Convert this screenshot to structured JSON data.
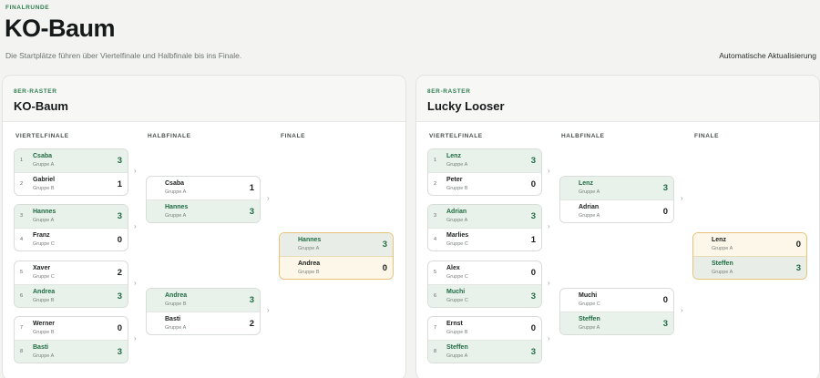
{
  "header": {
    "eyebrow": "FINALRUNDE",
    "title": "KO-Baum",
    "subtitle": "Die Startplätze führen über Viertelfinale und Halbfinale bis ins Finale.",
    "auto_refresh": "Automatische Aktualisierung"
  },
  "rounds": {
    "qf": "VIERTELFINALE",
    "sf": "HALBFINALE",
    "f": "FINALE"
  },
  "panels": [
    {
      "eyebrow": "8ER-RASTER",
      "title": "KO-Baum",
      "qf": [
        [
          {
            "seed": "1",
            "name": "Csaba",
            "group": "Gruppe A",
            "score": "3",
            "win": true
          },
          {
            "seed": "2",
            "name": "Gabriel",
            "group": "Gruppe B",
            "score": "1",
            "win": false
          }
        ],
        [
          {
            "seed": "3",
            "name": "Hannes",
            "group": "Gruppe A",
            "score": "3",
            "win": true
          },
          {
            "seed": "4",
            "name": "Franz",
            "group": "Gruppe C",
            "score": "0",
            "win": false
          }
        ],
        [
          {
            "seed": "5",
            "name": "Xaver",
            "group": "Gruppe C",
            "score": "2",
            "win": false
          },
          {
            "seed": "6",
            "name": "Andrea",
            "group": "Gruppe B",
            "score": "3",
            "win": true
          }
        ],
        [
          {
            "seed": "7",
            "name": "Werner",
            "group": "Gruppe B",
            "score": "0",
            "win": false
          },
          {
            "seed": "8",
            "name": "Basti",
            "group": "Gruppe A",
            "score": "3",
            "win": true
          }
        ]
      ],
      "sf": [
        [
          {
            "name": "Csaba",
            "group": "Gruppe A",
            "score": "1",
            "win": false
          },
          {
            "name": "Hannes",
            "group": "Gruppe A",
            "score": "3",
            "win": true
          }
        ],
        [
          {
            "name": "Andrea",
            "group": "Gruppe B",
            "score": "3",
            "win": true
          },
          {
            "name": "Basti",
            "group": "Gruppe A",
            "score": "2",
            "win": false
          }
        ]
      ],
      "f": [
        {
          "name": "Hannes",
          "group": "Gruppe A",
          "score": "3",
          "win": true
        },
        {
          "name": "Andrea",
          "group": "Gruppe B",
          "score": "0",
          "win": false
        }
      ]
    },
    {
      "eyebrow": "8ER-RASTER",
      "title": "Lucky Looser",
      "qf": [
        [
          {
            "seed": "1",
            "name": "Lenz",
            "group": "Gruppe A",
            "score": "3",
            "win": true
          },
          {
            "seed": "2",
            "name": "Peter",
            "group": "Gruppe B",
            "score": "0",
            "win": false
          }
        ],
        [
          {
            "seed": "3",
            "name": "Adrian",
            "group": "Gruppe A",
            "score": "3",
            "win": true
          },
          {
            "seed": "4",
            "name": "Marlies",
            "group": "Gruppe C",
            "score": "1",
            "win": false
          }
        ],
        [
          {
            "seed": "5",
            "name": "Alex",
            "group": "Gruppe C",
            "score": "0",
            "win": false
          },
          {
            "seed": "6",
            "name": "Muchi",
            "group": "Gruppe C",
            "score": "3",
            "win": true
          }
        ],
        [
          {
            "seed": "7",
            "name": "Ernst",
            "group": "Gruppe B",
            "score": "0",
            "win": false
          },
          {
            "seed": "8",
            "name": "Steffen",
            "group": "Gruppe A",
            "score": "3",
            "win": true
          }
        ]
      ],
      "sf": [
        [
          {
            "name": "Lenz",
            "group": "Gruppe A",
            "score": "3",
            "win": true
          },
          {
            "name": "Adrian",
            "group": "Gruppe A",
            "score": "0",
            "win": false
          }
        ],
        [
          {
            "name": "Muchi",
            "group": "Gruppe C",
            "score": "0",
            "win": false
          },
          {
            "name": "Steffen",
            "group": "Gruppe A",
            "score": "3",
            "win": true
          }
        ]
      ],
      "f": [
        {
          "name": "Lenz",
          "group": "Gruppe A",
          "score": "0",
          "win": false
        },
        {
          "name": "Steffen",
          "group": "Gruppe A",
          "score": "3",
          "win": true
        }
      ]
    }
  ],
  "icons": {
    "connector": "chevron-right-icon",
    "connector_glyph": "›"
  }
}
